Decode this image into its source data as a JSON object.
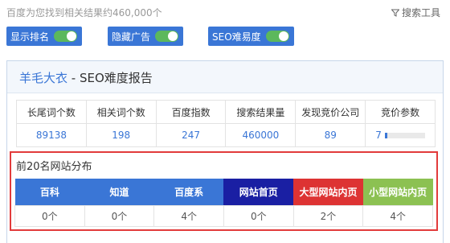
{
  "top": {
    "result_count": "百度为您找到相关结果约460,000个",
    "search_tools": "搜索工具",
    "search_tools_icon": "funnel-icon"
  },
  "toggles": [
    {
      "label": "显示排名",
      "on": true
    },
    {
      "label": "隐藏广告",
      "on": true
    },
    {
      "label": "SEO难易度",
      "on": true
    }
  ],
  "report": {
    "keyword": "羊毛大衣",
    "title_suffix": " - SEO难度报告",
    "stats_headers": [
      "长尾词个数",
      "相关词个数",
      "百度指数",
      "搜索结果量",
      "发现竞价公司",
      "竞价参数"
    ],
    "stats_values": [
      "89138",
      "198",
      "247",
      "460000",
      "89",
      "7"
    ],
    "bid_level_fraction": 0.07
  },
  "distribution": {
    "title": "前20名网站分布",
    "headers": [
      "百科",
      "知道",
      "百度系",
      "网站首页",
      "大型网站内页",
      "小型网站内页"
    ],
    "header_colors": [
      "#3a76d6",
      "#3a76d6",
      "#3a76d6",
      "#1a1fa3",
      "#dd3333",
      "#8cc152"
    ],
    "values": [
      "0个",
      "0个",
      "4个",
      "0个",
      "2个",
      "4个"
    ]
  },
  "colors": {
    "accent_blue": "#3a76d6",
    "toggle_green": "#5cb85c",
    "highlight_red": "#e23b3b"
  }
}
